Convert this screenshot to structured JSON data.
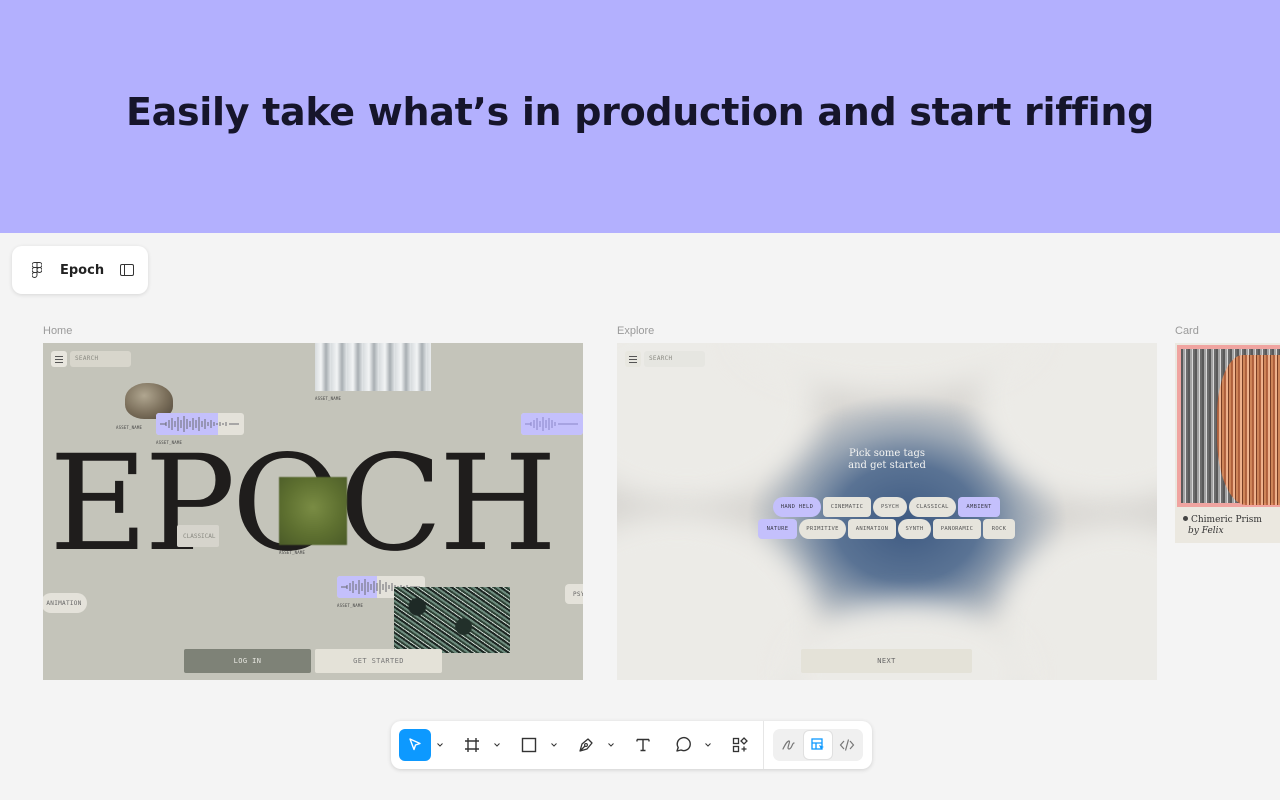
{
  "hero": {
    "headline": "Easily take what’s in production and start riffing"
  },
  "file": {
    "name": "Epoch"
  },
  "frames": {
    "home": {
      "label": "Home",
      "search_placeholder": "SEARCH",
      "title_word": "EPOCH",
      "asset_label": "ASSET_NAME",
      "chips": {
        "classical": "CLASSICAL",
        "animation": "ANIMATION",
        "psych": "PSY"
      },
      "buttons": {
        "login": "LOG IN",
        "get_started": "GET STARTED"
      }
    },
    "explore": {
      "label": "Explore",
      "search_placeholder": "SEARCH",
      "prompt_line1": "Pick some tags",
      "prompt_line2": "and get started",
      "tags_row1": [
        {
          "label": "HAND HELD",
          "selected": true
        },
        {
          "label": "CINEMATIC",
          "selected": false
        },
        {
          "label": "PSYCH",
          "selected": false
        },
        {
          "label": "CLASSICAL",
          "selected": false
        },
        {
          "label": "AMBIENT",
          "selected": true
        }
      ],
      "tags_row2": [
        {
          "label": "NATURE",
          "selected": true
        },
        {
          "label": "PRIMITIVE",
          "selected": false
        },
        {
          "label": "ANIMATION",
          "selected": false
        },
        {
          "label": "SYNTH",
          "selected": false
        },
        {
          "label": "PANORAMIC",
          "selected": false
        },
        {
          "label": "ROCK",
          "selected": false
        }
      ],
      "next_button": "NEXT"
    },
    "card": {
      "label": "Card",
      "title": "Chimeric Prism",
      "byline": "by Felix"
    }
  },
  "toolbar": {
    "tools": [
      "move-tool",
      "frame-tool",
      "shape-tool",
      "pen-tool",
      "text-tool",
      "comment-tool",
      "actions-tool"
    ],
    "modes": [
      "draw-mode",
      "design-mode",
      "dev-mode"
    ],
    "active_tool": "move-tool",
    "active_mode": "design-mode"
  },
  "colors": {
    "hero_bg": "#b3b0fe",
    "accent_blue": "#0d99ff",
    "tag_selected": "#c4c0fc"
  }
}
